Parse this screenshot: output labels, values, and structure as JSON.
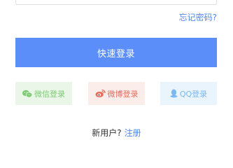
{
  "form": {
    "forgot_password_label": "忘记密码?",
    "login_button_label": "快速登录"
  },
  "social": {
    "wechat_label": "微信登录",
    "weibo_label": "微博登录",
    "qq_label": "QQ登录",
    "wechat_icon": "wechat-icon",
    "weibo_icon": "weibo-icon",
    "qq_icon": "qq-icon"
  },
  "footer": {
    "new_user_text": "新用户?",
    "register_label": "注册"
  },
  "colors": {
    "accent": "#5b8ef8",
    "link": "#4f87f7",
    "wechat": "#7ccb72",
    "weibo": "#ea6a5a",
    "qq": "#7cb8f0"
  }
}
